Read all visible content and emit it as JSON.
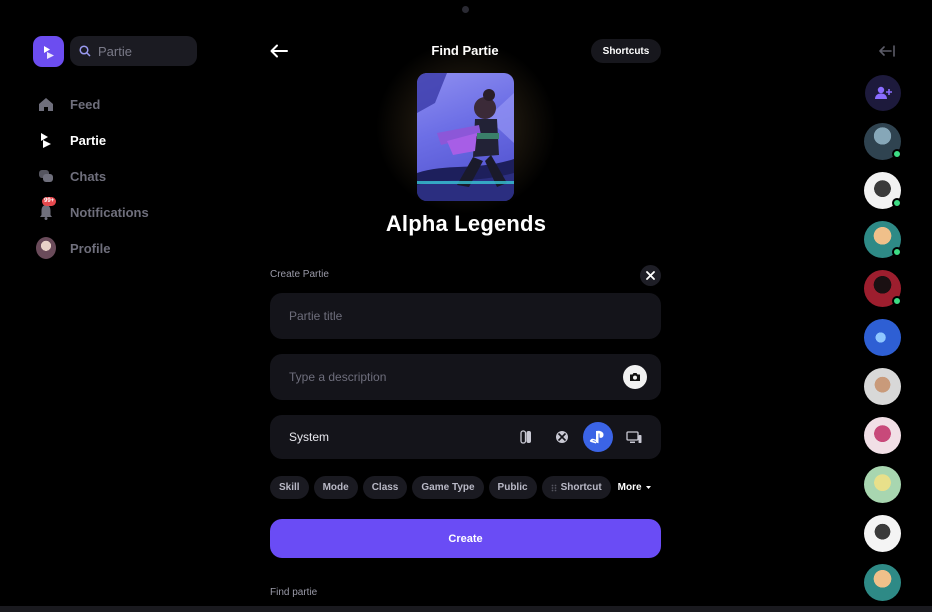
{
  "search": {
    "placeholder": "Partie"
  },
  "nav": {
    "items": [
      {
        "label": "Feed",
        "icon": "home-icon"
      },
      {
        "label": "Partie",
        "icon": "partie-logo-icon"
      },
      {
        "label": "Chats",
        "icon": "chats-icon"
      },
      {
        "label": "Notifications",
        "icon": "bell-icon",
        "badge": "99+"
      },
      {
        "label": "Profile",
        "icon": "avatar"
      }
    ],
    "active": "Partie"
  },
  "header": {
    "title": "Find Partie",
    "shortcuts_label": "Shortcuts"
  },
  "game": {
    "name": "Alpha Legends"
  },
  "create_form": {
    "section_label": "Create Partie",
    "title_placeholder": "Partie title",
    "description_placeholder": "Type a description",
    "system_label": "System",
    "platforms": [
      "switch-icon",
      "xbox-icon",
      "playstation-icon",
      "pc-icon"
    ],
    "selected_platform": "playstation-icon",
    "chips": [
      "Skill",
      "Mode",
      "Class",
      "Game Type",
      "Public",
      "Shortcut"
    ],
    "more_label": "More",
    "create_label": "Create"
  },
  "find_section": {
    "label": "Find partie"
  },
  "colors": {
    "accent": "#6a4cf5",
    "playstation": "#3b64e6",
    "online": "#3ddc84"
  }
}
